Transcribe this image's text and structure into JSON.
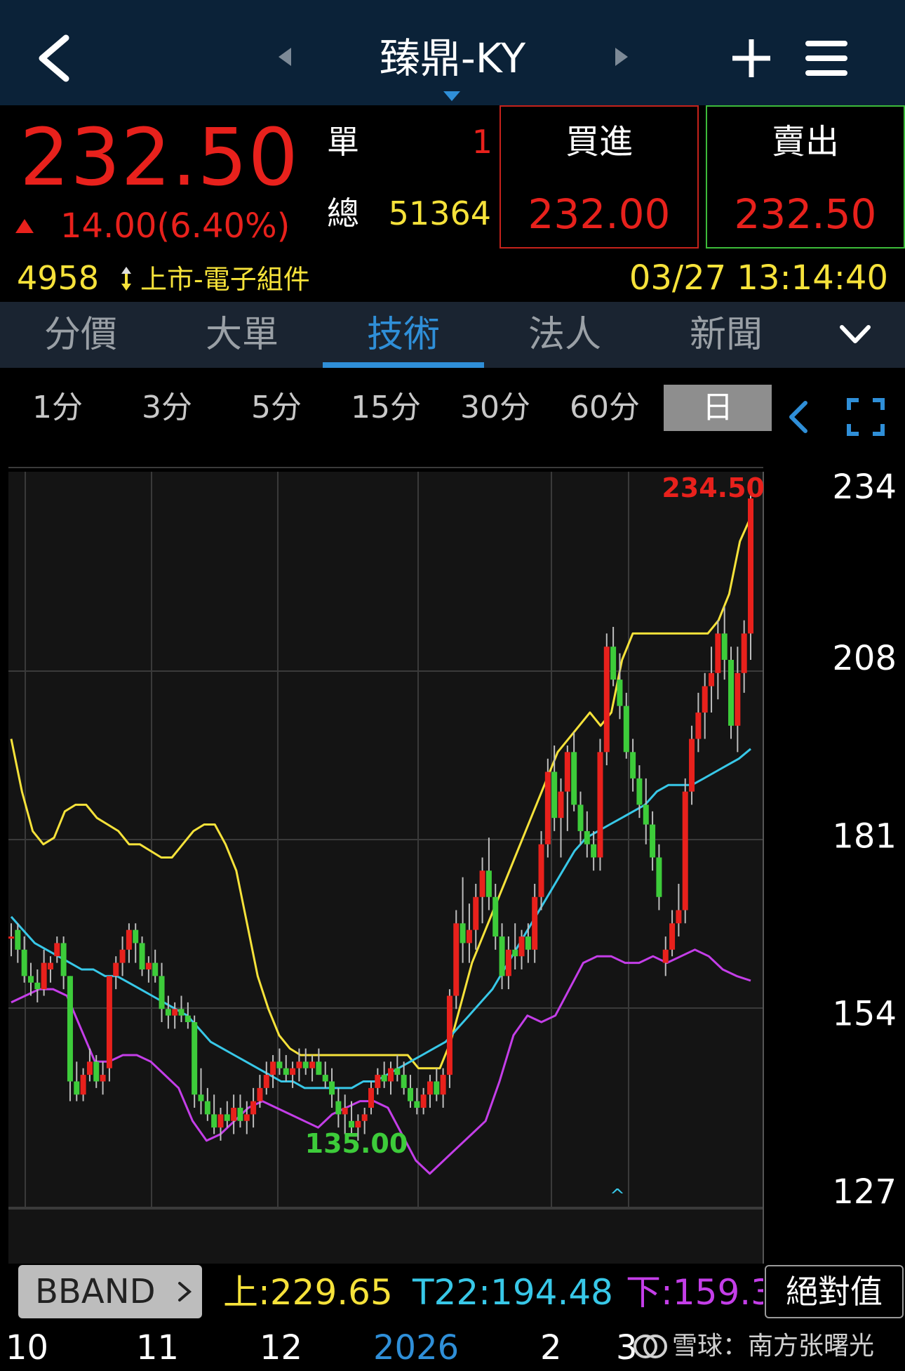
{
  "header": {
    "title": "臻鼎-KY",
    "icons": [
      "back-icon",
      "prev-stock-icon",
      "next-stock-icon",
      "plus-icon",
      "menu-icon"
    ]
  },
  "quote": {
    "price": "232.50",
    "change": "14.00(6.40%)",
    "dan_label": "單",
    "dan_value": "1",
    "zong_label": "總",
    "zong_value": "51364",
    "buy_label": "買進",
    "buy_price": "232.00",
    "sell_label": "賣出",
    "sell_price": "232.50",
    "code": "4958",
    "market": "上市-電子組件",
    "datetime": "03/27 13:14:40"
  },
  "tabs": [
    "分價",
    "大單",
    "技術",
    "法人",
    "新聞"
  ],
  "active_tab": 2,
  "intervals": [
    "1分",
    "3分",
    "5分",
    "15分",
    "30分",
    "60分",
    "日"
  ],
  "active_interval": 6,
  "indicator": {
    "name": "BBAND",
    "upper": "上:229.65",
    "mid": "T22:194.48",
    "lower": "下:159.3",
    "mode_button": "絕對值"
  },
  "watermark": "雪球：南方张曙光",
  "colors": {
    "up": "#e8211c",
    "down": "#3dcc3a",
    "upper": "#f6e23a",
    "mid": "#38c8e8",
    "lower": "#c43ee8",
    "bg": "#141414"
  },
  "chart_data": {
    "type": "candlestick",
    "y_ticks": [
      234,
      208,
      181,
      154,
      127
    ],
    "ylim": [
      124,
      238
    ],
    "x_tick_labels": [
      "10",
      "11",
      "12",
      "2026",
      "2",
      "3"
    ],
    "max_label": "234.50",
    "min_label": "135.00",
    "grid": true,
    "candles": [
      {
        "o": 166,
        "h": 168,
        "l": 163,
        "c": 166
      },
      {
        "o": 167,
        "h": 168,
        "l": 162,
        "c": 164
      },
      {
        "o": 164,
        "h": 166,
        "l": 159,
        "c": 160
      },
      {
        "o": 160,
        "h": 162,
        "l": 157,
        "c": 159
      },
      {
        "o": 159,
        "h": 161,
        "l": 156,
        "c": 158
      },
      {
        "o": 158,
        "h": 164,
        "l": 157,
        "c": 162
      },
      {
        "o": 161,
        "h": 163,
        "l": 159,
        "c": 162
      },
      {
        "o": 163,
        "h": 166,
        "l": 162,
        "c": 165
      },
      {
        "o": 165,
        "h": 166,
        "l": 158,
        "c": 160
      },
      {
        "o": 160,
        "h": 160,
        "l": 141,
        "c": 144
      },
      {
        "o": 144,
        "h": 147,
        "l": 141,
        "c": 142
      },
      {
        "o": 142,
        "h": 146,
        "l": 141,
        "c": 145
      },
      {
        "o": 145,
        "h": 149,
        "l": 144,
        "c": 147
      },
      {
        "o": 147,
        "h": 148,
        "l": 143,
        "c": 144
      },
      {
        "o": 144,
        "h": 147,
        "l": 142,
        "c": 145
      },
      {
        "o": 146,
        "h": 160,
        "l": 144,
        "c": 160
      },
      {
        "o": 160,
        "h": 163,
        "l": 158,
        "c": 162
      },
      {
        "o": 162,
        "h": 166,
        "l": 160,
        "c": 164
      },
      {
        "o": 164,
        "h": 168,
        "l": 162,
        "c": 167
      },
      {
        "o": 167,
        "h": 168,
        "l": 162,
        "c": 165
      },
      {
        "o": 165,
        "h": 166,
        "l": 160,
        "c": 161
      },
      {
        "o": 161,
        "h": 163,
        "l": 159,
        "c": 162
      },
      {
        "o": 162,
        "h": 164,
        "l": 159,
        "c": 160
      },
      {
        "o": 160,
        "h": 162,
        "l": 153,
        "c": 155
      },
      {
        "o": 155,
        "h": 157,
        "l": 152,
        "c": 154
      },
      {
        "o": 154,
        "h": 156,
        "l": 152,
        "c": 155
      },
      {
        "o": 155,
        "h": 157,
        "l": 153,
        "c": 154
      },
      {
        "o": 154,
        "h": 156,
        "l": 152,
        "c": 153
      },
      {
        "o": 153,
        "h": 154,
        "l": 140,
        "c": 142
      },
      {
        "o": 142,
        "h": 146,
        "l": 139,
        "c": 141
      },
      {
        "o": 141,
        "h": 143,
        "l": 138,
        "c": 139
      },
      {
        "o": 139,
        "h": 142,
        "l": 136,
        "c": 137
      },
      {
        "o": 137,
        "h": 140,
        "l": 135,
        "c": 139
      },
      {
        "o": 139,
        "h": 141,
        "l": 137,
        "c": 138
      },
      {
        "o": 138,
        "h": 142,
        "l": 136,
        "c": 140
      },
      {
        "o": 140,
        "h": 142,
        "l": 137,
        "c": 138
      },
      {
        "o": 138,
        "h": 141,
        "l": 136,
        "c": 139
      },
      {
        "o": 139,
        "h": 143,
        "l": 137,
        "c": 141
      },
      {
        "o": 141,
        "h": 145,
        "l": 140,
        "c": 143
      },
      {
        "o": 143,
        "h": 147,
        "l": 142,
        "c": 145
      },
      {
        "o": 145,
        "h": 148,
        "l": 143,
        "c": 147
      },
      {
        "o": 147,
        "h": 149,
        "l": 145,
        "c": 146
      },
      {
        "o": 146,
        "h": 148,
        "l": 144,
        "c": 145
      },
      {
        "o": 145,
        "h": 147,
        "l": 143,
        "c": 146
      },
      {
        "o": 146,
        "h": 149,
        "l": 144,
        "c": 147
      },
      {
        "o": 147,
        "h": 149,
        "l": 145,
        "c": 146
      },
      {
        "o": 146,
        "h": 148,
        "l": 144,
        "c": 147
      },
      {
        "o": 147,
        "h": 149,
        "l": 145,
        "c": 145
      },
      {
        "o": 145,
        "h": 147,
        "l": 143,
        "c": 144
      },
      {
        "o": 144,
        "h": 146,
        "l": 140,
        "c": 142
      },
      {
        "o": 141,
        "h": 143,
        "l": 137,
        "c": 139
      },
      {
        "o": 139,
        "h": 142,
        "l": 136,
        "c": 140
      },
      {
        "o": 138,
        "h": 141,
        "l": 136,
        "c": 137
      },
      {
        "o": 137,
        "h": 139,
        "l": 135,
        "c": 138
      },
      {
        "o": 138,
        "h": 140,
        "l": 136,
        "c": 139
      },
      {
        "o": 140,
        "h": 144,
        "l": 139,
        "c": 143
      },
      {
        "o": 143,
        "h": 146,
        "l": 142,
        "c": 145
      },
      {
        "o": 145,
        "h": 147,
        "l": 143,
        "c": 144
      },
      {
        "o": 144,
        "h": 147,
        "l": 142,
        "c": 146
      },
      {
        "o": 146,
        "h": 148,
        "l": 144,
        "c": 145
      },
      {
        "o": 145,
        "h": 147,
        "l": 142,
        "c": 143
      },
      {
        "o": 143,
        "h": 145,
        "l": 140,
        "c": 141
      },
      {
        "o": 141,
        "h": 143,
        "l": 139,
        "c": 140
      },
      {
        "o": 140,
        "h": 143,
        "l": 139,
        "c": 142
      },
      {
        "o": 142,
        "h": 145,
        "l": 140,
        "c": 144
      },
      {
        "o": 144,
        "h": 146,
        "l": 141,
        "c": 142
      },
      {
        "o": 142,
        "h": 146,
        "l": 140,
        "c": 145
      },
      {
        "o": 145,
        "h": 158,
        "l": 143,
        "c": 157
      },
      {
        "o": 157,
        "h": 170,
        "l": 155,
        "c": 168
      },
      {
        "o": 168,
        "h": 175,
        "l": 162,
        "c": 165
      },
      {
        "o": 165,
        "h": 171,
        "l": 162,
        "c": 167
      },
      {
        "o": 167,
        "h": 174,
        "l": 164,
        "c": 172
      },
      {
        "o": 172,
        "h": 178,
        "l": 168,
        "c": 176
      },
      {
        "o": 176,
        "h": 181,
        "l": 170,
        "c": 172
      },
      {
        "o": 172,
        "h": 174,
        "l": 164,
        "c": 166
      },
      {
        "o": 166,
        "h": 168,
        "l": 158,
        "c": 160
      },
      {
        "o": 160,
        "h": 166,
        "l": 158,
        "c": 164
      },
      {
        "o": 164,
        "h": 168,
        "l": 161,
        "c": 163
      },
      {
        "o": 163,
        "h": 167,
        "l": 161,
        "c": 166
      },
      {
        "o": 166,
        "h": 168,
        "l": 162,
        "c": 164
      },
      {
        "o": 164,
        "h": 174,
        "l": 162,
        "c": 172
      },
      {
        "o": 172,
        "h": 182,
        "l": 170,
        "c": 180
      },
      {
        "o": 180,
        "h": 193,
        "l": 178,
        "c": 191
      },
      {
        "o": 191,
        "h": 195,
        "l": 182,
        "c": 184
      },
      {
        "o": 184,
        "h": 190,
        "l": 178,
        "c": 188
      },
      {
        "o": 188,
        "h": 195,
        "l": 182,
        "c": 194
      },
      {
        "o": 194,
        "h": 197,
        "l": 185,
        "c": 186
      },
      {
        "o": 186,
        "h": 188,
        "l": 180,
        "c": 182
      },
      {
        "o": 182,
        "h": 185,
        "l": 178,
        "c": 180
      },
      {
        "o": 180,
        "h": 182,
        "l": 176,
        "c": 178
      },
      {
        "o": 178,
        "h": 196,
        "l": 176,
        "c": 194
      },
      {
        "o": 194,
        "h": 212,
        "l": 192,
        "c": 210
      },
      {
        "o": 210,
        "h": 213,
        "l": 204,
        "c": 205
      },
      {
        "o": 205,
        "h": 209,
        "l": 199,
        "c": 201
      },
      {
        "o": 201,
        "h": 203,
        "l": 193,
        "c": 194
      },
      {
        "o": 194,
        "h": 196,
        "l": 188,
        "c": 190
      },
      {
        "o": 190,
        "h": 192,
        "l": 184,
        "c": 186
      },
      {
        "o": 186,
        "h": 190,
        "l": 180,
        "c": 183
      },
      {
        "o": 183,
        "h": 185,
        "l": 176,
        "c": 178
      },
      {
        "o": 178,
        "h": 180,
        "l": 170,
        "c": 172
      },
      {
        "o": 162,
        "h": 166,
        "l": 160,
        "c": 164
      },
      {
        "o": 164,
        "h": 170,
        "l": 163,
        "c": 168
      },
      {
        "o": 168,
        "h": 174,
        "l": 166,
        "c": 170
      },
      {
        "o": 170,
        "h": 190,
        "l": 168,
        "c": 188
      },
      {
        "o": 188,
        "h": 198,
        "l": 186,
        "c": 196
      },
      {
        "o": 196,
        "h": 203,
        "l": 194,
        "c": 200
      },
      {
        "o": 200,
        "h": 206,
        "l": 196,
        "c": 204
      },
      {
        "o": 204,
        "h": 210,
        "l": 200,
        "c": 206
      },
      {
        "o": 206,
        "h": 214,
        "l": 202,
        "c": 212
      },
      {
        "o": 212,
        "h": 216,
        "l": 205,
        "c": 208
      },
      {
        "o": 208,
        "h": 210,
        "l": 196,
        "c": 198
      },
      {
        "o": 198,
        "h": 210,
        "l": 194,
        "c": 206
      },
      {
        "o": 206,
        "h": 214,
        "l": 203,
        "c": 212
      },
      {
        "o": 212,
        "h": 234.5,
        "l": 208,
        "c": 232.5
      }
    ],
    "series": [
      {
        "name": "上",
        "color": "#f6e23a",
        "values": [
          196,
          188,
          182,
          180,
          181,
          185,
          186,
          186,
          184,
          183,
          182,
          180,
          180,
          179,
          178,
          178,
          180,
          182,
          183,
          183,
          180,
          176,
          168,
          160,
          155,
          151,
          149,
          148,
          148,
          148,
          148,
          148,
          148,
          148,
          148,
          148,
          148,
          148,
          146,
          146,
          146,
          150,
          156,
          162,
          166,
          170,
          174,
          178,
          182,
          186,
          190,
          194,
          196,
          198,
          200,
          198,
          200,
          208,
          212,
          212,
          212,
          212,
          212,
          212,
          212,
          212,
          214,
          218,
          226,
          229.65
        ]
      },
      {
        "name": "T22",
        "color": "#38c8e8",
        "values": [
          169,
          167,
          165,
          164,
          163,
          162,
          161,
          161,
          160,
          160,
          159,
          158,
          157,
          156,
          155,
          154,
          152,
          150,
          149,
          148,
          147,
          146,
          145,
          144,
          144,
          143,
          143,
          143,
          143,
          143,
          144,
          144,
          145,
          146,
          147,
          148,
          149,
          150,
          152,
          154,
          156,
          158,
          161,
          164,
          167,
          170,
          173,
          176,
          179,
          181,
          182,
          183,
          184,
          185,
          186,
          188,
          189,
          189,
          189,
          190,
          191,
          192,
          193,
          194.48
        ]
      },
      {
        "name": "下",
        "color": "#c43ee8",
        "values": [
          156,
          157,
          158,
          158,
          157,
          152,
          147,
          147,
          148,
          148,
          147,
          145,
          143,
          138,
          135,
          136,
          138,
          140,
          141,
          140,
          139,
          138,
          137,
          139,
          140,
          141,
          141,
          140,
          136,
          132,
          130,
          132,
          134,
          136,
          138,
          144,
          151,
          154,
          153,
          154,
          158,
          162,
          163,
          163,
          162,
          162,
          163,
          162,
          163,
          164,
          163,
          161,
          160,
          159.3
        ]
      }
    ]
  }
}
